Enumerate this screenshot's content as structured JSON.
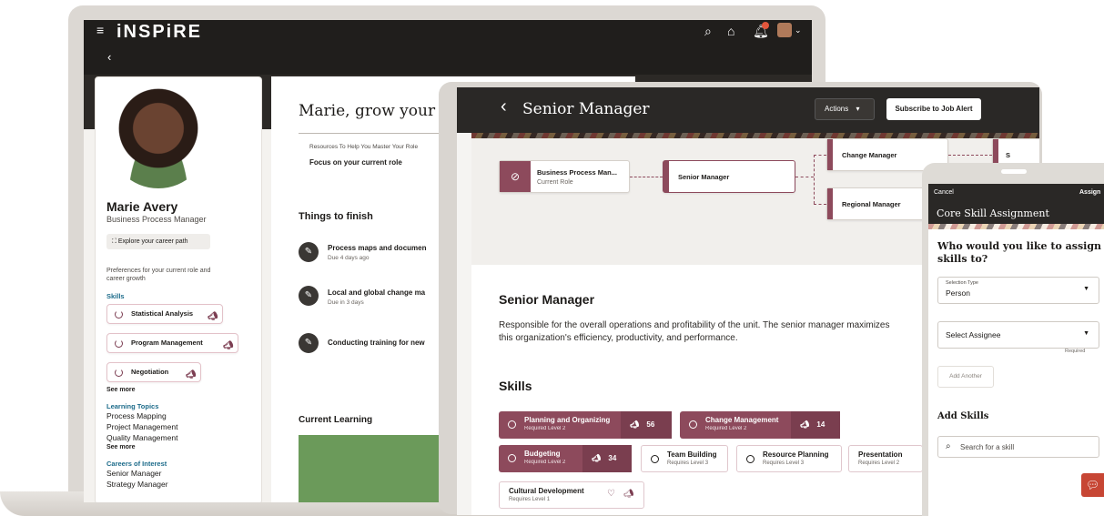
{
  "laptop": {
    "app_name": "iNSPiRE",
    "icons": {
      "menu": "menu-icon",
      "back": "chevron-left-icon",
      "search": "search-icon",
      "home": "home-icon",
      "notifications": "bell-icon"
    },
    "profile": {
      "name": "Marie Avery",
      "title": "Business Process Manager",
      "explore_button": "Explore your career path",
      "preferences_text": "Preferences for your current role and career growth",
      "skills_label": "Skills",
      "skills": [
        "Statistical Analysis",
        "Program Management",
        "Negotiation"
      ],
      "see_more": "See more",
      "learning_topics_label": "Learning Topics",
      "learning_topics": [
        "Process Mapping",
        "Project Management",
        "Quality Management"
      ],
      "learning_see_more": "See more",
      "careers_label": "Careers of Interest",
      "careers": [
        "Senior Manager",
        "Strategy Manager"
      ]
    },
    "main": {
      "greeting": "Marie, grow your ca",
      "resources_label": "Resources To Help You Master Your Role",
      "focus_label": "Focus on your current role",
      "things_title": "Things to finish",
      "tasks": [
        {
          "title": "Process maps and documen",
          "due": "Due 4 days ago"
        },
        {
          "title": "Local and global change ma",
          "due": "Due in 3 days"
        },
        {
          "title": "Conducting training for new",
          "due": ""
        }
      ],
      "current_learning_title": "Current Learning"
    }
  },
  "tablet": {
    "title": "Senior Manager",
    "actions_label": "Actions",
    "subscribe_label": "Subscribe to Job Alert",
    "path": {
      "current": {
        "title": "Business Process Man...",
        "subtitle": "Current Role"
      },
      "selected": {
        "title": "Senior Manager"
      },
      "next": [
        {
          "title": "Change Manager"
        },
        {
          "title": "Regional Manager"
        }
      ],
      "far_next": "S"
    },
    "role_title": "Senior Manager",
    "role_description": "Responsible for the overall operations and profitability of the unit. The senior manager maximizes this organization's efficiency, productivity, and performance.",
    "skills_title": "Skills",
    "skills": [
      {
        "name": "Planning and Organizing",
        "level": "Required Level 2",
        "count": "56"
      },
      {
        "name": "Change Management",
        "level": "Required Level 2",
        "count": "14"
      },
      {
        "name": "Budgeting",
        "level": "Required Level 2",
        "count": "34"
      },
      {
        "name": "Team Building",
        "level": "Requires Level 3"
      },
      {
        "name": "Resource Planning",
        "level": "Requires Level 3"
      },
      {
        "name": "Presentation",
        "level": "Requires Level 2"
      },
      {
        "name": "Cultural Development",
        "level": "Requires Level 1"
      }
    ]
  },
  "phone": {
    "cancel_label": "Cancel",
    "assign_label": "Assign",
    "title": "Core Skill Assignment",
    "question": "Who would you like to assign skills to?",
    "selection_type_label": "Selection Type",
    "selection_type_value": "Person",
    "assignee_placeholder": "Select Assignee",
    "required_label": "Required",
    "add_another_label": "Add Another",
    "add_skills_title": "Add Skills",
    "search_placeholder": "Search for a skill"
  },
  "colors": {
    "accent": "#8d4a5c",
    "header": "#2a2826",
    "link": "#1c6b8a",
    "chat": "#c74634"
  }
}
